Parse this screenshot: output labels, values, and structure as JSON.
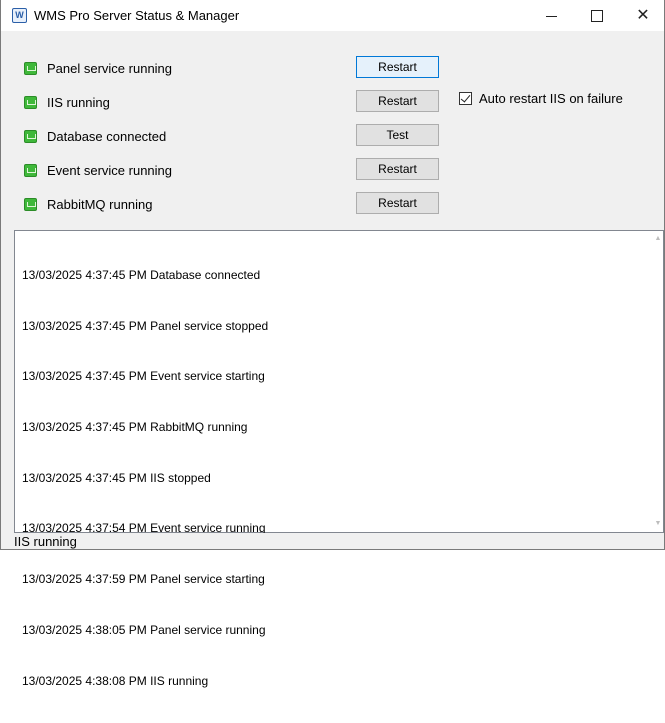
{
  "window": {
    "title": "WMS Pro Server Status & Manager",
    "app_icon_glyph": "W"
  },
  "caption_buttons": {
    "close_glyph": "✕"
  },
  "services": [
    {
      "label": "Panel service running",
      "status_color": "#3fb83a",
      "button": "Restart"
    },
    {
      "label": "IIS running",
      "status_color": "#3fb83a",
      "button": "Restart"
    },
    {
      "label": "Database connected",
      "status_color": "#3fb83a",
      "button": "Test"
    },
    {
      "label": "Event service running",
      "status_color": "#3fb83a",
      "button": "Restart"
    },
    {
      "label": "RabbitMQ running",
      "status_color": "#3fb83a",
      "button": "Restart"
    }
  ],
  "auto_restart": {
    "label": "Auto restart IIS on failure",
    "checked": true
  },
  "log": {
    "lines": [
      "13/03/2025 4:37:45 PM Database connected",
      "13/03/2025 4:37:45 PM Panel service stopped",
      "13/03/2025 4:37:45 PM Event service starting",
      "13/03/2025 4:37:45 PM RabbitMQ running",
      "13/03/2025 4:37:45 PM IIS stopped",
      "13/03/2025 4:37:54 PM Event service running",
      "13/03/2025 4:37:59 PM Panel service starting",
      "13/03/2025 4:38:05 PM Panel service running",
      "13/03/2025 4:38:08 PM IIS running"
    ]
  },
  "statusbar": {
    "text": "IIS running"
  },
  "icons": {
    "app": "app-icon",
    "status": "server-status-icon",
    "minimize": "minimize-icon",
    "maximize": "maximize-icon",
    "close": "close-icon"
  }
}
